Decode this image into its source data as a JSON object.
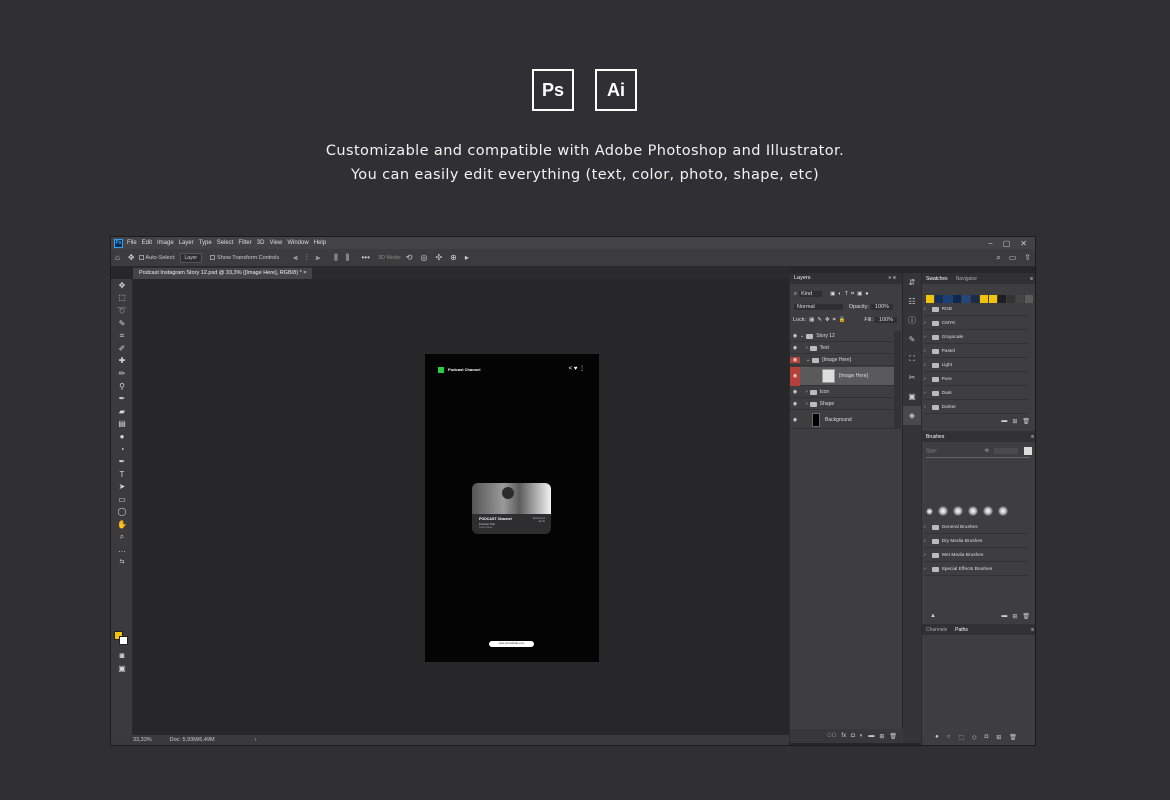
{
  "badges": [
    "Ps",
    "Ai"
  ],
  "tagline": {
    "line1": "Customizable and compatible with Adobe Photoshop and Illustrator.",
    "line2": "You can easily edit everything (text, color, photo, shape, etc)"
  },
  "app": {
    "logo": "Ps",
    "menu": [
      "File",
      "Edit",
      "Image",
      "Layer",
      "Type",
      "Select",
      "Filter",
      "3D",
      "View",
      "Window",
      "Help"
    ],
    "window_controls": [
      "−",
      "▢",
      "✕"
    ]
  },
  "options": {
    "auto_select_label": "Auto-Select:",
    "auto_select_value": "Layer",
    "transform_label": "Show Transform Controls",
    "mode_label": "3D Mode:"
  },
  "document": {
    "tab_title": "Podcast Instagram Story 12.psd @ 33,3% ([Image Here], RGB/8) *",
    "zoom": "33,33%",
    "doc_size": "Doc: 5,93M/6,49M"
  },
  "canvas": {
    "channel_name": "Podcast Channel",
    "card_title": "PODCAST Channel",
    "card_subtitle": "Podcast Title",
    "card_meta": "Guest Name",
    "card_right_line1": "Episode 01",
    "card_right_line2": "Ep.00",
    "pill_text": "www.yourwebsite.com"
  },
  "layers_panel": {
    "tab": "Layers",
    "kind_filter": "Kind",
    "blend_mode": "Normal",
    "opacity_label": "Opacity:",
    "opacity_value": "100%",
    "lock_label": "Lock:",
    "fill_label": "Fill:",
    "fill_value": "100%",
    "layers": [
      "Story 12",
      "Text",
      "[Image Here]",
      "[Image Here]",
      "Icon",
      "Shape",
      "Background"
    ],
    "footer_icons": [
      "GO",
      "fx",
      "◘",
      "◐",
      "▬",
      "⊞",
      "🗑"
    ]
  },
  "swatches_panel": {
    "tabs": [
      "Swatches",
      "Navigator"
    ],
    "swatch_colors": [
      "#f3c20a",
      "#11305e",
      "#1a3f7a",
      "#0a2850",
      "#26477d",
      "#1b2b49",
      "#f3c20a",
      "#f3c20a",
      "#1e1e1e",
      "#333333",
      "#444444",
      "#5a5a5a",
      "#777777"
    ],
    "groups": [
      "RGB",
      "CMYK",
      "Grayscale",
      "Pastel",
      "Light",
      "Pure",
      "Dark",
      "Darker"
    ]
  },
  "brushes_panel": {
    "tab": "Brushes",
    "size_label": "Size:",
    "groups": [
      "General Brushes",
      "Dry Media Brushes",
      "Wet Media Brushes",
      "Special Effects Brushes"
    ]
  },
  "paths_panel": {
    "tabs": [
      "Channels",
      "Paths"
    ]
  }
}
